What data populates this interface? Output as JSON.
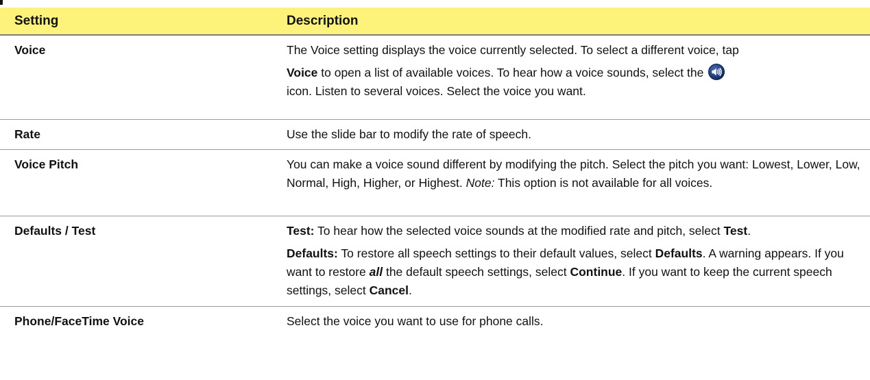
{
  "table": {
    "headers": {
      "setting": "Setting",
      "description": "Description"
    },
    "rows": [
      {
        "setting": "Voice",
        "desc": {
          "p1": "The Voice setting displays the voice currently selected. To select a different voice, tap",
          "voice_bold": "Voice",
          "p2": " to open a list of available voices. To hear how a voice sounds, select the ",
          "p3": "icon. Listen to several voices. Select the voice you want.",
          "icon": "speaker-icon"
        }
      },
      {
        "setting": "Rate",
        "desc": {
          "text": "Use the slide bar to modify the rate of speech."
        }
      },
      {
        "setting": "Voice Pitch",
        "desc": {
          "p1": "You can make a voice sound different by modifying the pitch. Select the pitch you want: Lowest, Lower, Low, Normal, High, Higher, or Highest. ",
          "note_label": "Note:",
          "p2": " This option is not available for all voices."
        }
      },
      {
        "setting": "Defaults / Test",
        "desc": {
          "test_label": "Test:",
          "test_text": " To hear how the selected voice sounds at the modified rate and pitch, select ",
          "test_bold": "Test",
          "test_end": ".",
          "defaults_label": "Defaults:",
          "defaults_text1": " To restore all speech settings to their default values, select ",
          "defaults_bold": "Defaults",
          "defaults_text2": ". A warning appears. If you want to restore ",
          "all_emph": "all",
          "defaults_text3": " the default speech settings, select ",
          "continue_bold": "Continue",
          "defaults_text4": ". If you want to keep the current speech settings, select ",
          "cancel_bold": "Cancel",
          "defaults_end": "."
        }
      },
      {
        "setting": "Phone/FaceTime Voice",
        "desc": {
          "text": "Select the voice you want to use for phone calls."
        }
      }
    ]
  }
}
